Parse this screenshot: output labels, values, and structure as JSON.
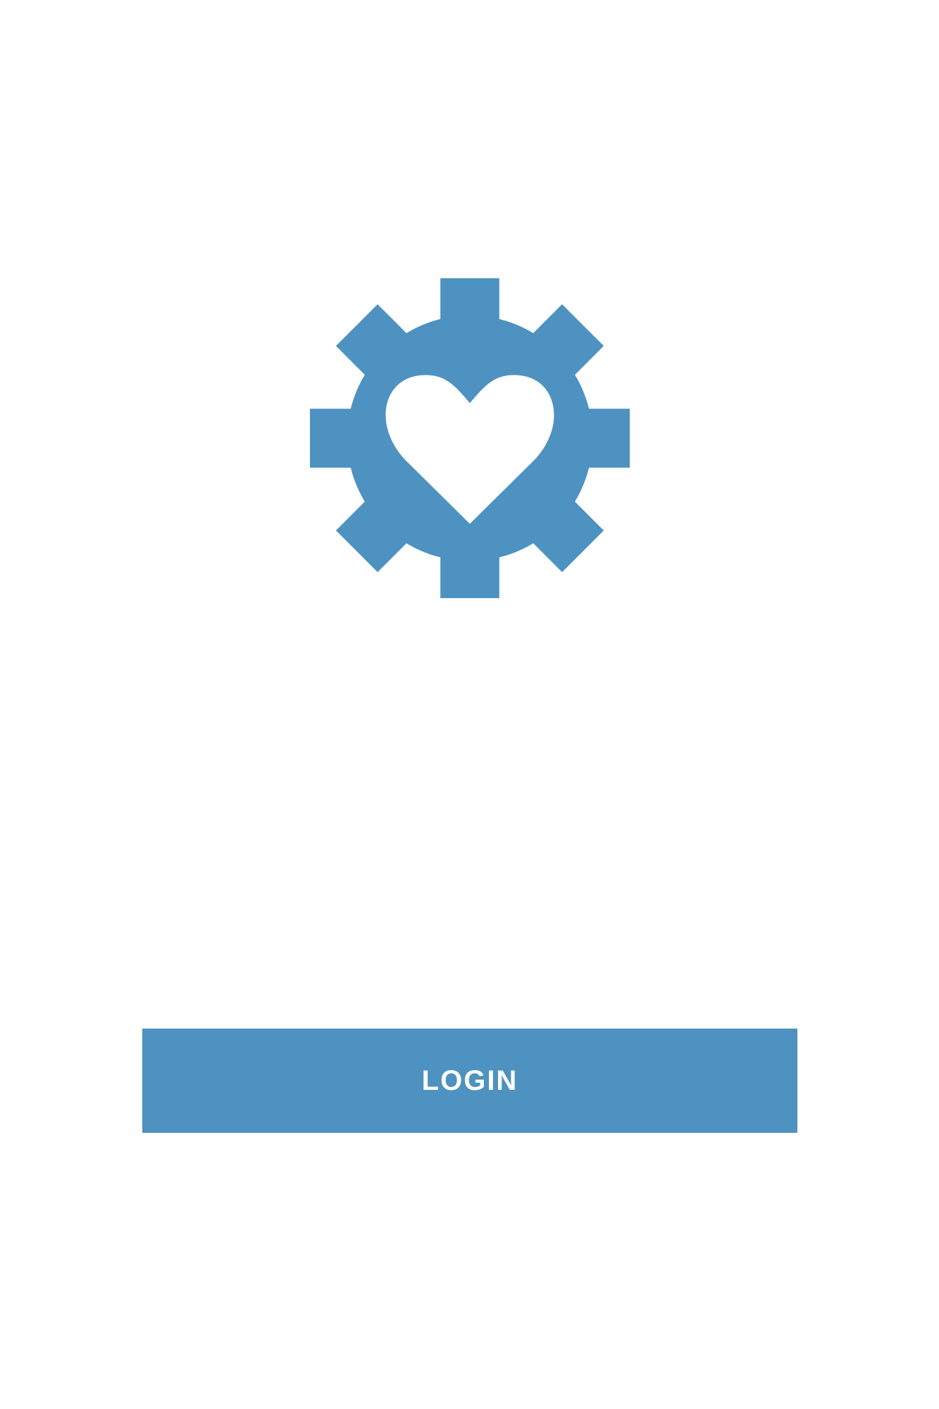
{
  "colors": {
    "accent": "#4d92c1",
    "background": "#ffffff",
    "button_text": "#ffffff"
  },
  "logo": {
    "icon": "gear-heart-icon"
  },
  "login_button": {
    "label": "LOGIN"
  }
}
